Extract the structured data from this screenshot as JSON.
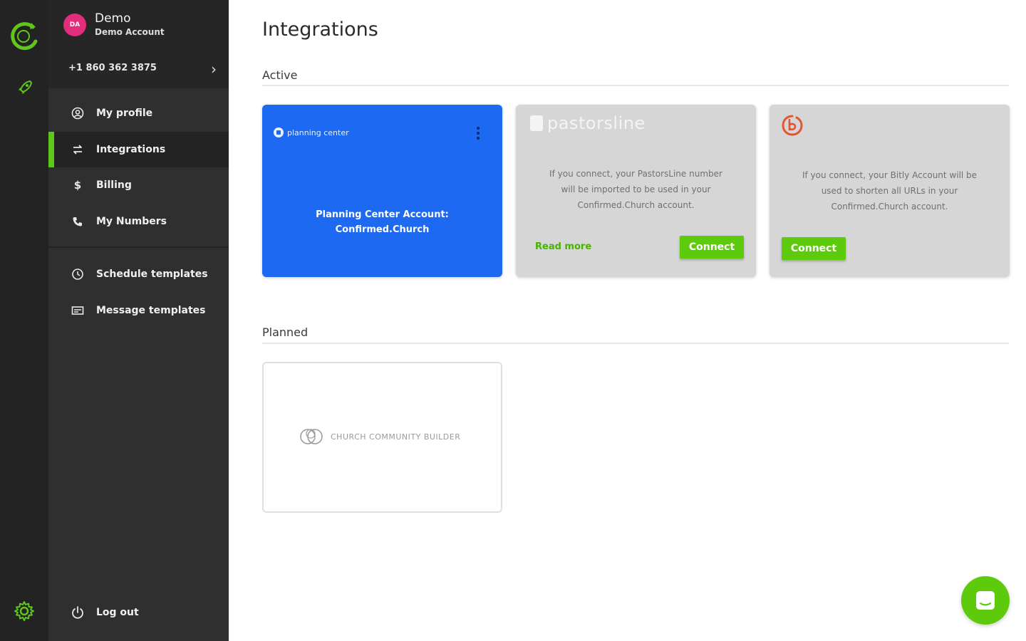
{
  "rail": {
    "logo": "confirmed-church-logo",
    "rocket": "rocket-icon",
    "settings": "gear-icon",
    "accent": "#5fc61b"
  },
  "account": {
    "initials": "DA",
    "name": "Demo",
    "subtitle": "Demo Account",
    "phone": "+1 860 362 3875",
    "avatar_color": "#e22d7a"
  },
  "nav": {
    "items": [
      {
        "label": "My profile",
        "icon": "user-circle-icon"
      },
      {
        "label": "Integrations",
        "icon": "swap-icon",
        "active": true
      },
      {
        "label": "Billing",
        "icon": "dollar-icon"
      },
      {
        "label": "My Numbers",
        "icon": "phone-icon"
      },
      {
        "label": "Schedule templates",
        "icon": "clock-icon"
      },
      {
        "label": "Message templates",
        "icon": "message-icon"
      }
    ],
    "logout": {
      "label": "Log out",
      "icon": "power-icon"
    }
  },
  "main": {
    "title": "Integrations",
    "active_label": "Active",
    "planned_label": "Planned",
    "planning_center": {
      "logo_text": "planning center",
      "text_line1": "Planning Center Account:",
      "text_line2": "Confirmed.Church",
      "color": "#1d69f2"
    },
    "pastorsline": {
      "logo_text": "pastorsline",
      "desc_line1": "If you connect, your PastorsLine number",
      "desc_line2": "will be imported to be used in your",
      "desc_line3": "Confirmed.Church account.",
      "read_more": "Read more",
      "connect": "Connect"
    },
    "bitly": {
      "logo": "bitly-logo",
      "desc_line1": "If you connect, your Bitly Account will be",
      "desc_line2": "used to shorten all URLs in your",
      "desc_line3": "Confirmed.Church account.",
      "connect": "Connect"
    },
    "ccb": {
      "logo_text": "CHURCH COMMUNITY BUILDER"
    }
  },
  "chat": {
    "icon": "chat-icon",
    "color": "#5dcb0c"
  }
}
